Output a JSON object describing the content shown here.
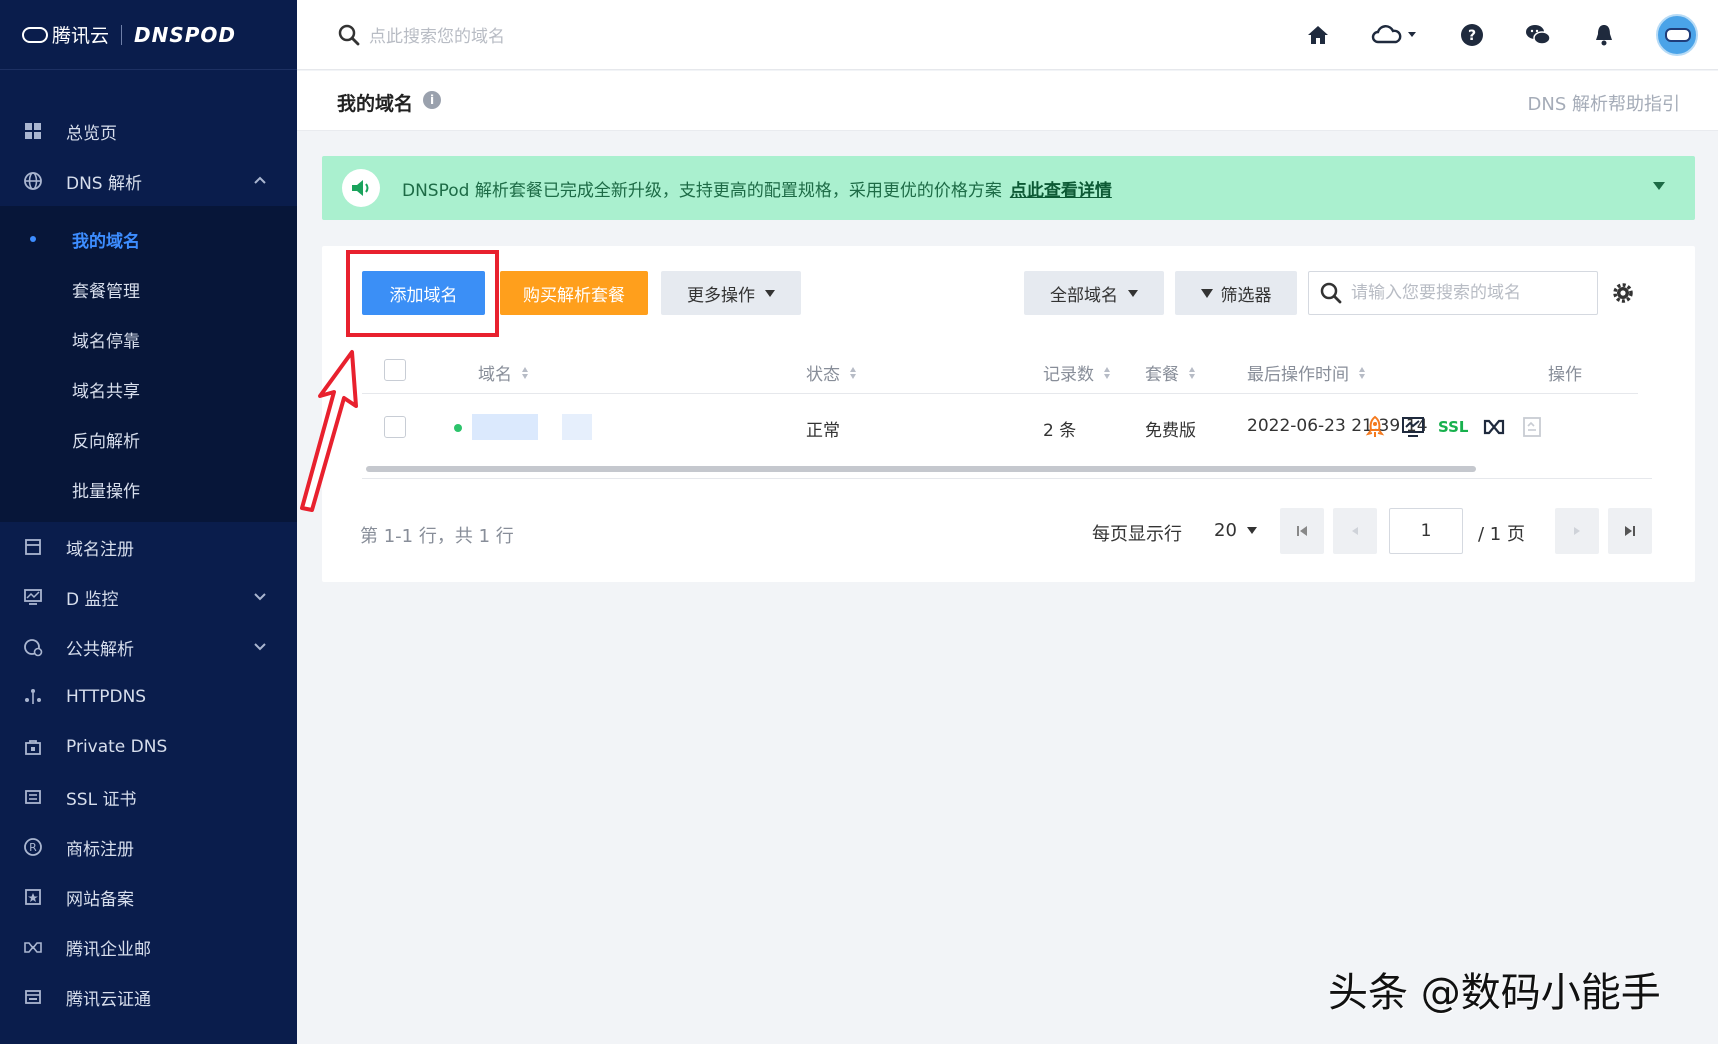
{
  "brand": {
    "tencent": "腾讯云",
    "dnspod": "DNSPOD"
  },
  "sidebar": {
    "items": [
      {
        "label": "总览页",
        "icon": "dashboard-icon"
      },
      {
        "label": "DNS 解析",
        "icon": "globe-icon",
        "expanded": true
      },
      {
        "label": "域名注册",
        "icon": "register-icon"
      },
      {
        "label": "D 监控",
        "icon": "monitor-icon"
      },
      {
        "label": "公共解析",
        "icon": "public-dns-icon"
      },
      {
        "label": "HTTPDNS",
        "icon": "httpdns-icon"
      },
      {
        "label": "Private DNS",
        "icon": "private-dns-icon"
      },
      {
        "label": "SSL 证书",
        "icon": "ssl-cert-icon"
      },
      {
        "label": "商标注册",
        "icon": "trademark-icon"
      },
      {
        "label": "网站备案",
        "icon": "icp-filing-icon"
      },
      {
        "label": "腾讯企业邮",
        "icon": "mail-icon"
      },
      {
        "label": "腾讯云证通",
        "icon": "certificate-icon"
      }
    ],
    "dns_sub": [
      {
        "label": "我的域名",
        "active": true
      },
      {
        "label": "套餐管理"
      },
      {
        "label": "域名停靠"
      },
      {
        "label": "域名共享"
      },
      {
        "label": "反向解析"
      },
      {
        "label": "批量操作"
      }
    ]
  },
  "topbar": {
    "search_placeholder": "点此搜索您的域名"
  },
  "page": {
    "title": "我的域名",
    "help_link": "DNS 解析帮助指引"
  },
  "banner": {
    "text": "DNSPod 解析套餐已完成全新升级，支持更高的配置规格，采用更优的价格方案",
    "link": "点此查看详情"
  },
  "toolbar": {
    "add_domain": "添加域名",
    "buy_package": "购买解析套餐",
    "more_actions": "更多操作",
    "all_domains": "全部域名",
    "filter": "筛选器",
    "search_placeholder": "请输入您要搜索的域名"
  },
  "table": {
    "headers": {
      "domain": "域名",
      "status": "状态",
      "records": "记录数",
      "package": "套餐",
      "last_op": "最后操作时间",
      "actions": "操作"
    },
    "rows": [
      {
        "status": "正常",
        "records": "2 条",
        "package": "免费版",
        "last_op": "2022-06-23 21:39:14",
        "ssl": "SSL"
      }
    ]
  },
  "pagination": {
    "summary": "第 1-1 行，共 1 行",
    "per_page_label": "每页显示行",
    "per_page": "20",
    "current_page": "1",
    "total_pages": "/ 1 页"
  },
  "watermark": "头条 @数码小能手",
  "colors": {
    "sidebar_bg": "#0a1d4c",
    "primary": "#3b8ff6",
    "orange": "#ff9f1c",
    "banner_bg": "#aaf0cf",
    "highlight": "#e8212e"
  }
}
